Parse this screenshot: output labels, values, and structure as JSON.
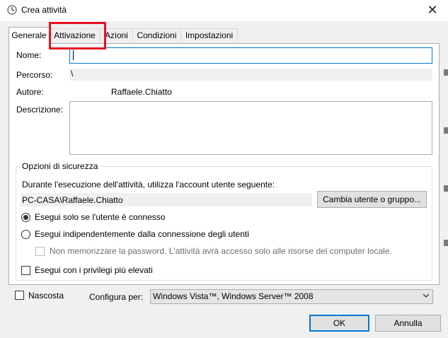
{
  "window": {
    "title": "Crea attività",
    "close_glyph": "✕"
  },
  "tabs": [
    {
      "label": "Generale",
      "active": true
    },
    {
      "label": "Attivazione",
      "active": false,
      "highlighted": true
    },
    {
      "label": "Azioni",
      "active": false
    },
    {
      "label": "Condizioni",
      "active": false
    },
    {
      "label": "Impostazioni",
      "active": false
    }
  ],
  "general": {
    "name_label": "Nome:",
    "name_value": "",
    "path_label": "Percorso:",
    "path_value": "\\",
    "author_label": "Autore:",
    "author_value": "Raffaele.Chiatto",
    "description_label": "Descrizione:",
    "description_value": ""
  },
  "security": {
    "legend": "Opzioni di sicurezza",
    "account_prompt": "Durante l'esecuzione dell'attività, utilizza l'account utente seguente:",
    "account_value": "PC-CASA\\Raffaele.Chiatto",
    "change_user_label": "Cambia utente o gruppo...",
    "radio_logged_on": "Esegui solo se l'utente è connesso",
    "radio_logged_on_selected": true,
    "radio_always": "Esegui indipendentemente dalla connessione degli utenti",
    "radio_always_selected": false,
    "no_store_password": "Non memorizzare la password. L'attività avrà accesso solo alle risorse del computer locale.",
    "no_store_password_checked": false,
    "highest_privileges": "Esegui con i privilegi più elevati",
    "highest_privileges_checked": false
  },
  "footer": {
    "hidden_label": "Nascosta",
    "hidden_checked": false,
    "configure_label": "Configura per:",
    "configure_value": "Windows Vista™, Windows Server™ 2008",
    "ok_label": "OK",
    "cancel_label": "Annulla"
  },
  "colors": {
    "highlight": "#e81123",
    "focus": "#0078d7",
    "background": "#f0f0f0"
  },
  "icons": {
    "app": "clock-icon",
    "close": "close-icon",
    "dropdown": "chevron-down-icon"
  }
}
